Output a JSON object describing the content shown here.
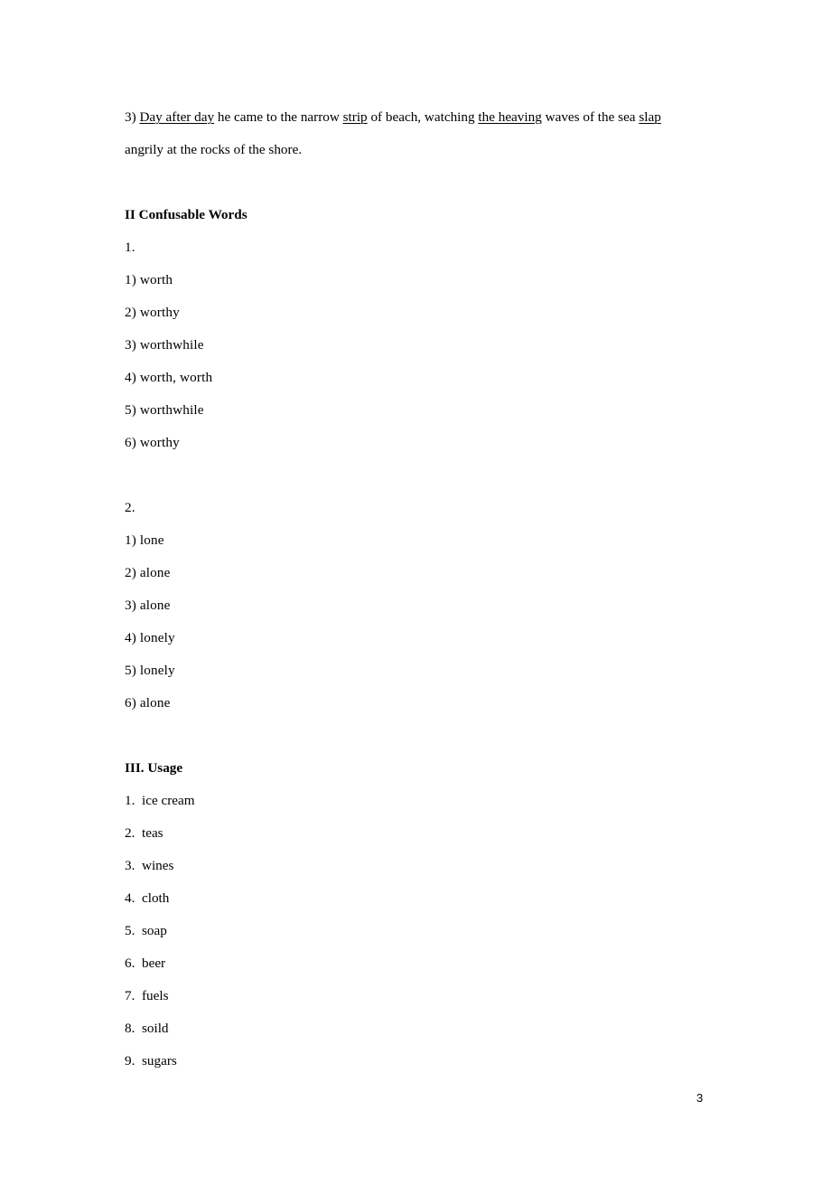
{
  "document": {
    "page_number": "3",
    "background_color": "#ffffff",
    "text_color": "#000000"
  },
  "exercise_paragraph": {
    "number": "3)",
    "line1": {
      "segments": [
        {
          "text": "3) ",
          "underline": false
        },
        {
          "text": "Day after day",
          "underline": true
        },
        {
          "text": " he came to the narrow ",
          "underline": false
        },
        {
          "text": "strip",
          "underline": true
        },
        {
          "text": " of beach, watching ",
          "underline": false
        },
        {
          "text": "the heaving",
          "underline": true
        },
        {
          "text": " waves of the sea ",
          "underline": false
        },
        {
          "text": "slap",
          "underline": true
        }
      ],
      "plain": "3) Day after day he came to the narrow strip of beach, watching the heaving waves of the sea slap"
    },
    "line2": "angrily at the rocks of the shore."
  },
  "section_confusable": {
    "numeral": "II",
    "title": "Confusable Words",
    "heading_full": "II Confusable Words",
    "groups": [
      {
        "label": "1.",
        "items": [
          "1) worth",
          "2) worthy",
          "3) worthwhile",
          "4) worth, worth",
          "5) worthwhile",
          "6) worthy"
        ]
      },
      {
        "label": "2.",
        "items": [
          "1) lone",
          "2) alone",
          "3) alone",
          "4) lonely",
          "5) lonely",
          "6) alone"
        ]
      }
    ]
  },
  "section_usage": {
    "numeral": "III.",
    "title": "Usage",
    "heading_full": "III. Usage",
    "items": [
      "1.  ice cream",
      "2.  teas",
      "3.  wines",
      "4.  cloth",
      "5.  soap",
      "6.  beer",
      "7.  fuels",
      "8.  soild",
      "9.  sugars"
    ]
  }
}
